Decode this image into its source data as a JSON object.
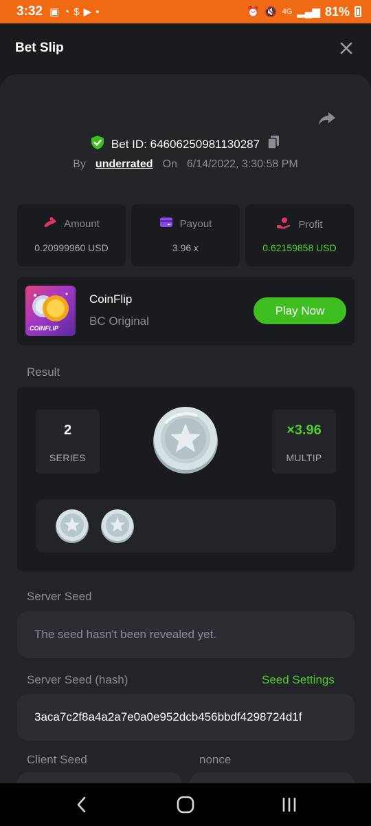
{
  "status_bar": {
    "time": "3:32",
    "battery": "81%",
    "network": "4G"
  },
  "header": {
    "title": "Bet Slip"
  },
  "bet": {
    "id_text": "Bet ID: 64606250981130287",
    "by_label": "By",
    "username": "underrated",
    "on_label": "On",
    "datetime": "6/14/2022, 3:30:58 PM"
  },
  "stats": [
    {
      "label": "Amount",
      "value": "0.20999960 USD"
    },
    {
      "label": "Payout",
      "value": "3.96 x"
    },
    {
      "label": "Profit",
      "value": "0.62159858 USD"
    }
  ],
  "game": {
    "name": "CoinFlip",
    "subtitle": "BC Original",
    "thumb_text": "COINFLIP",
    "play_label": "Play Now"
  },
  "result": {
    "label": "Result",
    "series_value": "2",
    "series_label": "SERIES",
    "multiplier_value": "×3.96",
    "multiplier_label": "MULTIP"
  },
  "server_seed": {
    "label": "Server Seed",
    "placeholder": "The seed hasn't been revealed yet."
  },
  "server_seed_hash": {
    "label": "Server Seed (hash)",
    "settings_label": "Seed Settings",
    "value": "3aca7c2f8a4a2a7e0a0e952dcb456bbdf4298724d1f"
  },
  "client_seed": {
    "label": "Client Seed"
  },
  "nonce": {
    "label": "nonce"
  },
  "colors": {
    "status_bar": "#f06a13",
    "background": "#1a1b1f",
    "panel": "#232428",
    "accent_green": "#4fcc2e",
    "button_green": "#3fbf1f"
  },
  "icons": [
    "close-icon",
    "share-icon",
    "shield-check-icon",
    "copy-icon",
    "amount-icon",
    "payout-icon",
    "profit-icon",
    "coin-icon",
    "back-icon",
    "home-icon",
    "recents-icon"
  ]
}
